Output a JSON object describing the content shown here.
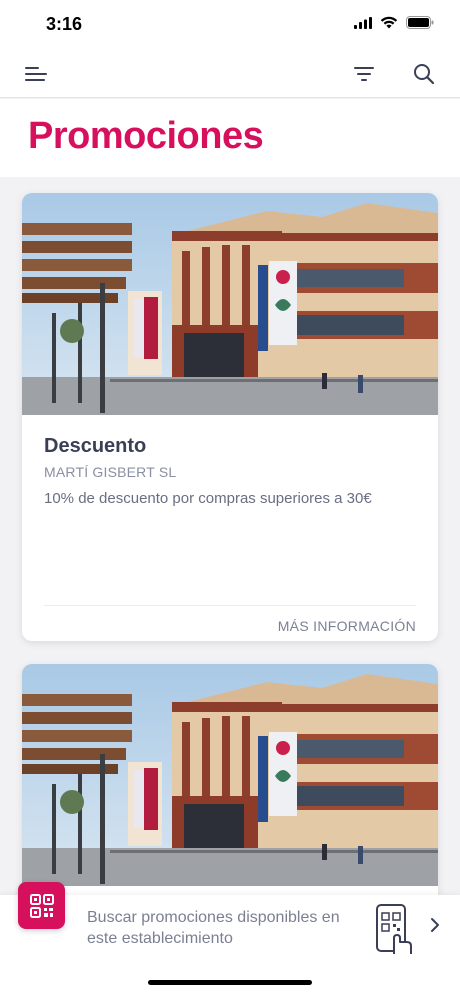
{
  "status_bar": {
    "time": "3:16",
    "icons": [
      "signal-icon",
      "wifi-icon",
      "battery-icon"
    ]
  },
  "nav": {
    "icons": [
      "menu-icon",
      "filter-icon",
      "search-icon"
    ]
  },
  "page": {
    "title": "Promociones",
    "accent_color": "#d7105e"
  },
  "promotions": [
    {
      "title": "Descuento",
      "company": "MARTÍ GISBERT SL",
      "description": "10% de descuento por compras superiores a 30€",
      "more_info": "MÁS INFORMACIÓN",
      "image": "market-building-photo"
    },
    {
      "image": "market-building-photo"
    }
  ],
  "banner": {
    "qr_icon": "qr-code-icon",
    "text": "Buscar promociones disponibles en este establecimiento",
    "phone_icon": "phone-qr-icon",
    "chevron_icon": "chevron-right-icon"
  }
}
